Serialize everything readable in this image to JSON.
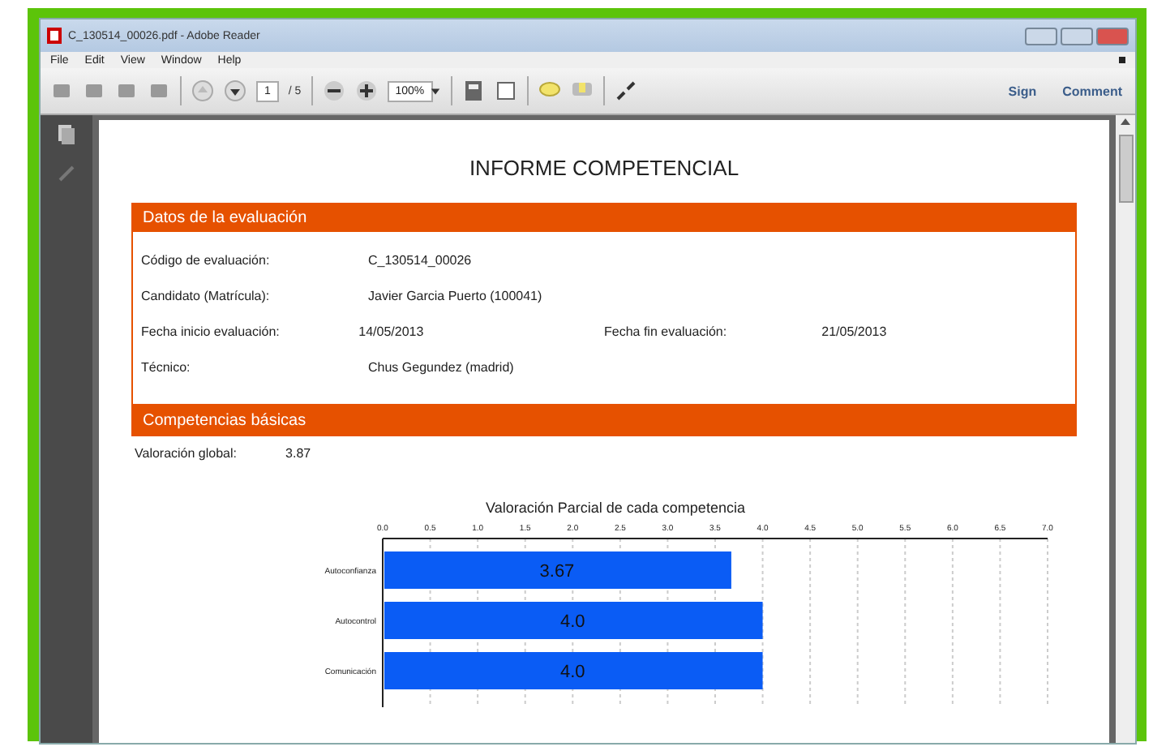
{
  "window": {
    "title": "C_130514_00026.pdf - Adobe Reader"
  },
  "menu": [
    "File",
    "Edit",
    "View",
    "Window",
    "Help"
  ],
  "toolbar": {
    "page": "1",
    "page_count": "/ 5",
    "zoom": "100%",
    "actions": [
      "Sign",
      "Comment"
    ]
  },
  "document": {
    "title": "INFORME COMPETENCIAL",
    "sections": [
      {
        "heading": "Datos de la evaluación",
        "rows": [
          {
            "fields": [
              {
                "label": "Código de evaluación:",
                "value": "C_130514_00026"
              }
            ]
          },
          {
            "fields": [
              {
                "label": "Candidato (Matrícula):",
                "value": "Javier Garcia Puerto (100041)"
              }
            ]
          },
          {
            "fields": [
              {
                "label": "Fecha inicio evaluación:",
                "value": "14/05/2013"
              },
              {
                "label": "Fecha fin evaluación:",
                "value": "21/05/2013"
              }
            ]
          },
          {
            "fields": [
              {
                "label": "Técnico:",
                "value": "Chus Gegundez (madrid)"
              }
            ]
          }
        ]
      },
      {
        "heading": "Competencias básicas"
      }
    ],
    "global": {
      "label": "Valoración global:",
      "value": "3.87"
    },
    "chart_data": {
      "type": "bar",
      "orientation": "horizontal",
      "title": "Valoración Parcial de cada competencia",
      "categories": [
        "Autoconfianza",
        "Autocontrol",
        "Comunicación"
      ],
      "series": [
        {
          "color": "#0a5cf5",
          "values": [
            3.67,
            4.0,
            4.0
          ]
        }
      ],
      "grid": true,
      "value_labels": [
        "3.67",
        "4.0",
        "4.0"
      ],
      "xlim": [
        0,
        7
      ],
      "xticks": [
        {
          "value": 0,
          "label": "0.0"
        },
        {
          "value": 0.5,
          "label": "0.5"
        },
        {
          "value": 1,
          "label": "1.0"
        },
        {
          "value": 1.5,
          "label": "1.5"
        },
        {
          "value": 2,
          "label": "2.0"
        },
        {
          "value": 2.5,
          "label": "2.5"
        },
        {
          "value": 3,
          "label": "3.0"
        },
        {
          "value": 3.5,
          "label": "3.5"
        },
        {
          "value": 4,
          "label": "4.0"
        },
        {
          "value": 4.5,
          "label": "4.5"
        },
        {
          "value": 5,
          "label": "5.0"
        },
        {
          "value": 5.5,
          "label": "5.5"
        },
        {
          "value": 6,
          "label": "6.0"
        },
        {
          "value": 6.5,
          "label": "6.5"
        },
        {
          "value": 7,
          "label": "7.0"
        }
      ]
    }
  }
}
